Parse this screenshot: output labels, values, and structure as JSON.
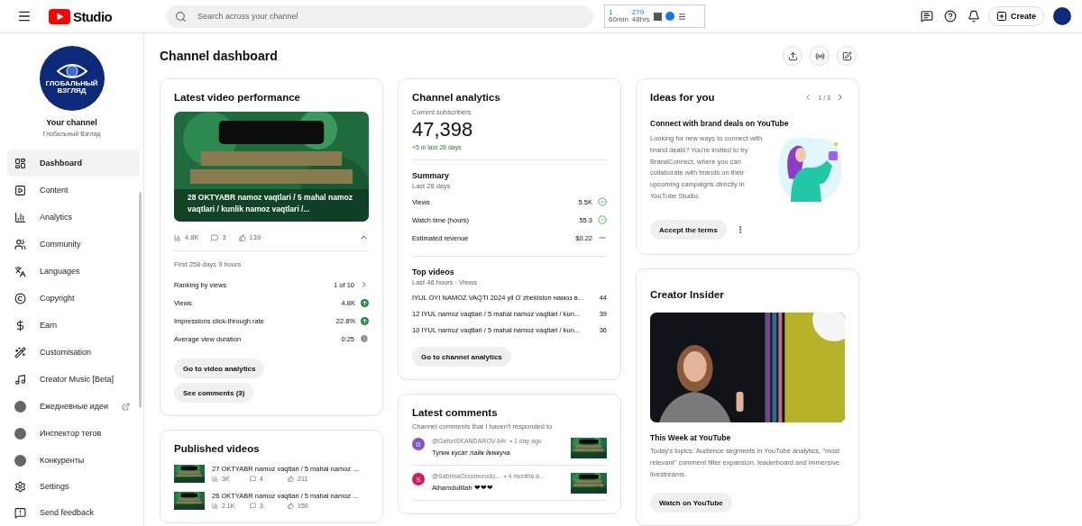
{
  "topbar": {
    "logo": "Studio",
    "search_placeholder": "Search across your channel",
    "widget": {
      "count": "1",
      "count_unit": "60min",
      "total": "279",
      "total_unit": "48hrs"
    },
    "create": "Create"
  },
  "sidebar": {
    "logo_text": [
      "ГЛОБАЛЬНЫЙ",
      "ВЗГЛЯД"
    ],
    "channel_label": "Your channel",
    "channel_name": "Глобальный Взгляд",
    "items": [
      {
        "label": "Dashboard",
        "selected": true,
        "external": false
      },
      {
        "label": "Content",
        "selected": false,
        "external": false
      },
      {
        "label": "Analytics",
        "selected": false,
        "external": false
      },
      {
        "label": "Community",
        "selected": false,
        "external": false
      },
      {
        "label": "Languages",
        "selected": false,
        "external": false
      },
      {
        "label": "Copyright",
        "selected": false,
        "external": false
      },
      {
        "label": "Earn",
        "selected": false,
        "external": false
      },
      {
        "label": "Customisation",
        "selected": false,
        "external": false
      },
      {
        "label": "Creator Music [Beta]",
        "selected": false,
        "external": false
      },
      {
        "label": "Ежедневные идеи",
        "selected": false,
        "external": true
      },
      {
        "label": "Инспектор тегов",
        "selected": false,
        "external": false
      },
      {
        "label": "Конкуренты",
        "selected": false,
        "external": false
      }
    ],
    "bottom_items": [
      {
        "label": "Settings",
        "selected": false
      },
      {
        "label": "Send feedback",
        "selected": false
      }
    ]
  },
  "page_title": "Channel dashboard",
  "latest_video": {
    "title": "Latest video performance",
    "video_title": "28 OKTYABR namoz vaqtlari / 5 mahal namoz vaqtlari / kunlik namoz vaqtlari /...",
    "views": "4.8K",
    "comments": "3",
    "likes": "139",
    "expanded": true,
    "period": "First 258 days 9 hours",
    "rows": [
      {
        "label": "Ranking by views",
        "value": "1 of 10",
        "kind": "link"
      },
      {
        "label": "Views",
        "value": "4.8K",
        "kind": "up"
      },
      {
        "label": "Impressions click-through rate",
        "value": "22.8%",
        "kind": "up"
      },
      {
        "label": "Average view duration",
        "value": "0:25",
        "kind": "neutral"
      }
    ],
    "buttons": [
      "Go to video analytics",
      "See comments (3)"
    ]
  },
  "published": {
    "title": "Published videos",
    "videos": [
      {
        "title": "27 OKTYABR namoz vaqtlari / 5 mahal namoz ...",
        "views": "3K",
        "comments": "4",
        "likes": "211"
      },
      {
        "title": "26 OKTYABR namoz vaqtlari / 5 mahal namoz ...",
        "views": "2.1K",
        "comments": "3",
        "likes": "150"
      }
    ]
  },
  "analytics": {
    "title": "Channel analytics",
    "subscribers_label": "Current subscribers",
    "subscribers": "47,398",
    "change": "+5 in last 28 days",
    "summary_title": "Summary",
    "summary_period": "Last 28 days",
    "summary": [
      {
        "label": "Views",
        "value": "5.5K",
        "good": true
      },
      {
        "label": "Watch time (hours)",
        "value": "55.3",
        "good": true
      },
      {
        "label": "Estimated revenue",
        "value": "$0.22",
        "good": false
      }
    ],
    "top_title": "Top videos",
    "top_period": "Last 48 hours · Views",
    "top": [
      {
        "title": "IYUL OYI NAMOZ VAQTI 2024 yil O`zbekiston намоз в...",
        "views": "44"
      },
      {
        "title": "12 IYUL namoz vaqtlari / 5 mahal namoz vaqtlari / kun...",
        "views": "39"
      },
      {
        "title": "10 IYUL namoz vaqtlari / 5 mahal namoz vaqtlari / kun...",
        "views": "36"
      }
    ],
    "button": "Go to channel analytics"
  },
  "comments": {
    "title": "Latest comments",
    "subtitle": "Channel comments that I haven't responded to",
    "items": [
      {
        "initial": "G",
        "color": "#7e57c2",
        "author": "@GafurISKANDAROV-b4r",
        "time": "• 1 day ago",
        "text": "Тупик кусат лайк йиккуча"
      },
      {
        "initial": "S",
        "color": "#d81b60",
        "author": "@SabrinaOrzumurodo...",
        "time": "• 4 months a...",
        "text": "Alhamdulillah ❤❤❤"
      }
    ]
  },
  "ideas": {
    "title": "Ideas for you",
    "pager": "1 / 3",
    "heading": "Connect with brand deals on YouTube",
    "text": "Looking for new ways to connect with brand deals? You're invited to try BrandConnect, where you can collaborate with brands on their upcoming campaigns directly in YouTube Studio.",
    "button": "Accept the terms"
  },
  "insider": {
    "title": "Creator Insider",
    "video_title": "This Week at YouTube",
    "text": "Today's topics: Audience segments in YouTube analytics, \"most relevant\" comment filter expansion, leaderboard and immersive livestreams.",
    "button": "Watch on YouTube"
  }
}
